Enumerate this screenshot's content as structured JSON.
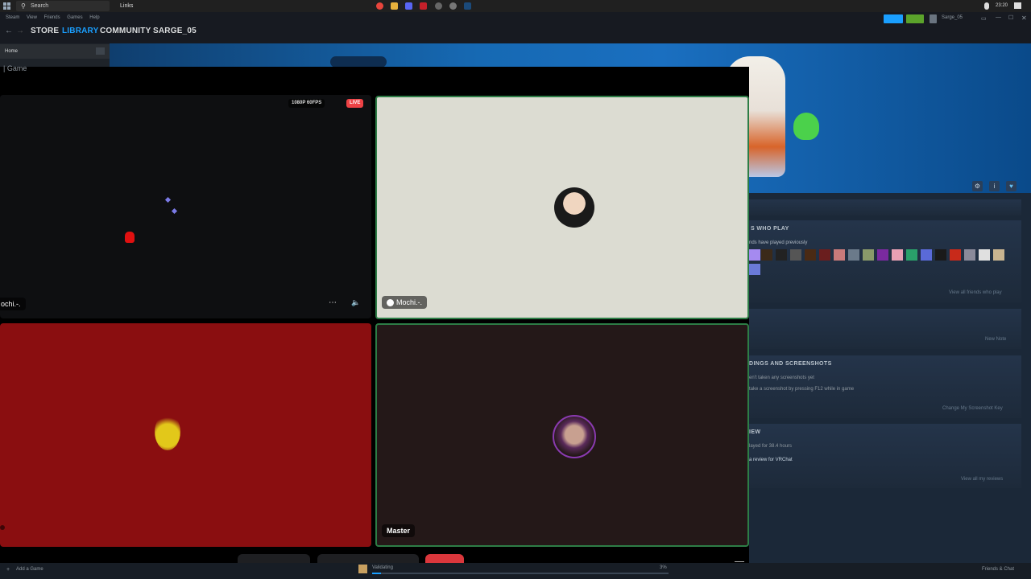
{
  "taskbar": {
    "search_placeholder": "Search",
    "links_label": "Links",
    "clock": "23:20"
  },
  "steam": {
    "menu": [
      "Steam",
      "View",
      "Friends",
      "Games",
      "Help"
    ],
    "nav_tabs": [
      "STORE",
      "LIBRARY",
      "COMMUNITY",
      "SARGE_05"
    ],
    "username": "Sarge_05",
    "sidebar_home": "Home"
  },
  "overlay": {
    "title": "| Game",
    "quality_badge": "1080P 60FPS",
    "live_badge": "LIVE",
    "tiles": [
      {
        "name": "ochi.-."
      },
      {
        "name": "Mochi.-."
      },
      {
        "name": ""
      },
      {
        "name": "Master"
      }
    ]
  },
  "right_panel": {
    "friends_head": "S WHO PLAY",
    "friends_sub": "nds have played previously",
    "friends_link": "View all friends who play",
    "notes_link": "New Note",
    "screens_head": "DINGS AND SCREENSHOTS",
    "screens_line1": "en't taken any screenshots yet",
    "screens_line2": "take a screenshot by pressing F12 while in game",
    "screens_link": "Change My Screenshot Key",
    "review_head": "IEW",
    "review_line1": "layed for 38.4 hours",
    "review_line2": "a review for VRChat",
    "review_link": "View all my reviews"
  },
  "bottom": {
    "add_game": "Add a Game",
    "download_status": "Validating",
    "download_percent": "3%",
    "friends_chat": "Friends & Chat"
  },
  "colors": {
    "accent": "#1a9fff",
    "live": "#ed4245",
    "speaking_border": "#2d7d46"
  }
}
